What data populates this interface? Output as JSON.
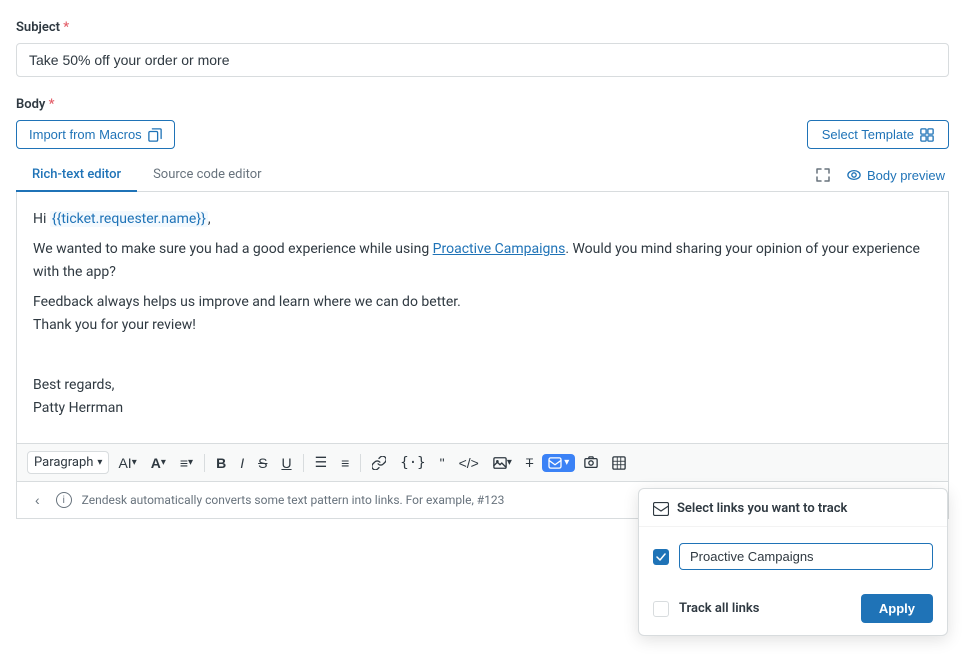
{
  "subject": {
    "label": "Subject",
    "required": "*",
    "value": "Take 50% off your order or more"
  },
  "body": {
    "label": "Body",
    "required": "*"
  },
  "toolbar": {
    "import_label": "Import from Macros",
    "select_template_label": "Select Template"
  },
  "tabs": {
    "rich_text": "Rich-text editor",
    "source_code": "Source code editor"
  },
  "editor": {
    "body_preview_label": "Body preview",
    "content_line1_before": "Hi ",
    "content_macro": "{{ticket.requester.name}}",
    "content_line1_after": ",",
    "content_line2": "We wanted to make sure you had a good experience while using ",
    "content_link": "Proactive Campaigns",
    "content_line2_after": ". Would you mind sharing your opinion of your experience with the app?",
    "content_line3": "Feedback always helps us improve and learn where we can do better.",
    "content_line4": "Thank you for your review!",
    "content_line5": "",
    "content_line6": "Best regards,",
    "content_line7": "Patty Herrman"
  },
  "format_toolbar": {
    "paragraph_label": "Paragraph",
    "ai_label": "AI",
    "bold": "B",
    "italic": "I",
    "strikethrough": "S",
    "underline": "U"
  },
  "info_bar": {
    "info_text": "Zendesk automatically converts some text pattern into links. For example, #123"
  },
  "link_tracker": {
    "header": "Select links you want to track",
    "link_name": "Proactive Campaigns",
    "track_all_label": "Track all links",
    "apply_label": "Apply"
  }
}
